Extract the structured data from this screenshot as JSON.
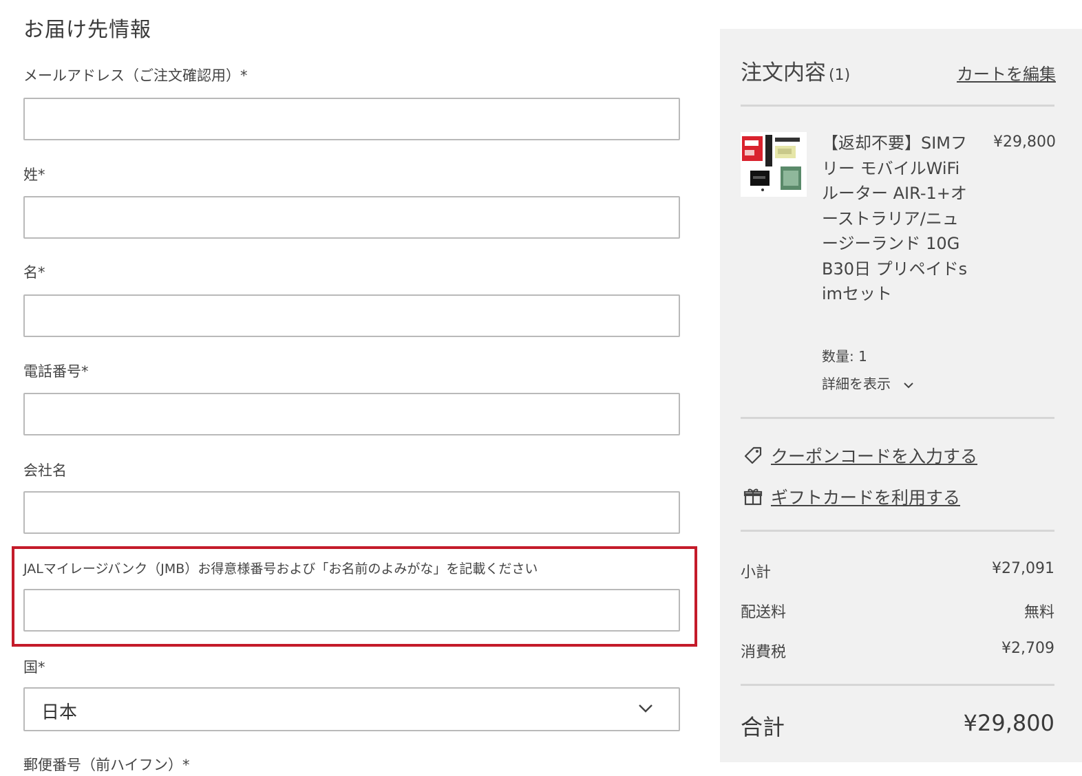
{
  "shipping": {
    "section_title": "お届け先情報",
    "email_label": "メールアドレス（ご注文確認用）*",
    "last_name_label": "姓*",
    "first_name_label": "名*",
    "phone_label": "電話番号*",
    "company_label": "会社名",
    "jmb_label": "JALマイレージバンク（JMB）お得意様番号および「お名前のよみがな」を記載ください",
    "country_label": "国*",
    "country_value": "日本",
    "postal_label": "郵便番号（前ハイフン）*"
  },
  "summary": {
    "title": "注文内容",
    "count": "(1)",
    "edit_cart": "カートを編集",
    "product": {
      "name": "【返却不要】SIMフリー モバイルWiFiルーター AIR-1+オーストラリア/ニュージーランド 10GB30日 プリペイドsimセット",
      "price": "¥29,800",
      "quantity": "数量: 1",
      "details": "詳細を表示"
    },
    "coupon_link": "クーポンコードを入力する",
    "gift_link": "ギフトカードを利用する",
    "subtotal_label": "小計",
    "subtotal_value": "¥27,091",
    "shipping_label": "配送料",
    "shipping_value": "無料",
    "tax_label": "消費税",
    "tax_value": "¥2,709",
    "total_label": "合計",
    "total_value": "¥29,800"
  },
  "colors": {
    "highlight": "#c41b2a",
    "summary_bg": "#f1f1f1",
    "border": "#b9b9b9"
  },
  "icons": {
    "coupon": "tag-icon",
    "gift": "gift-icon",
    "select": "chevron-down-icon",
    "details": "chevron-down-icon"
  }
}
